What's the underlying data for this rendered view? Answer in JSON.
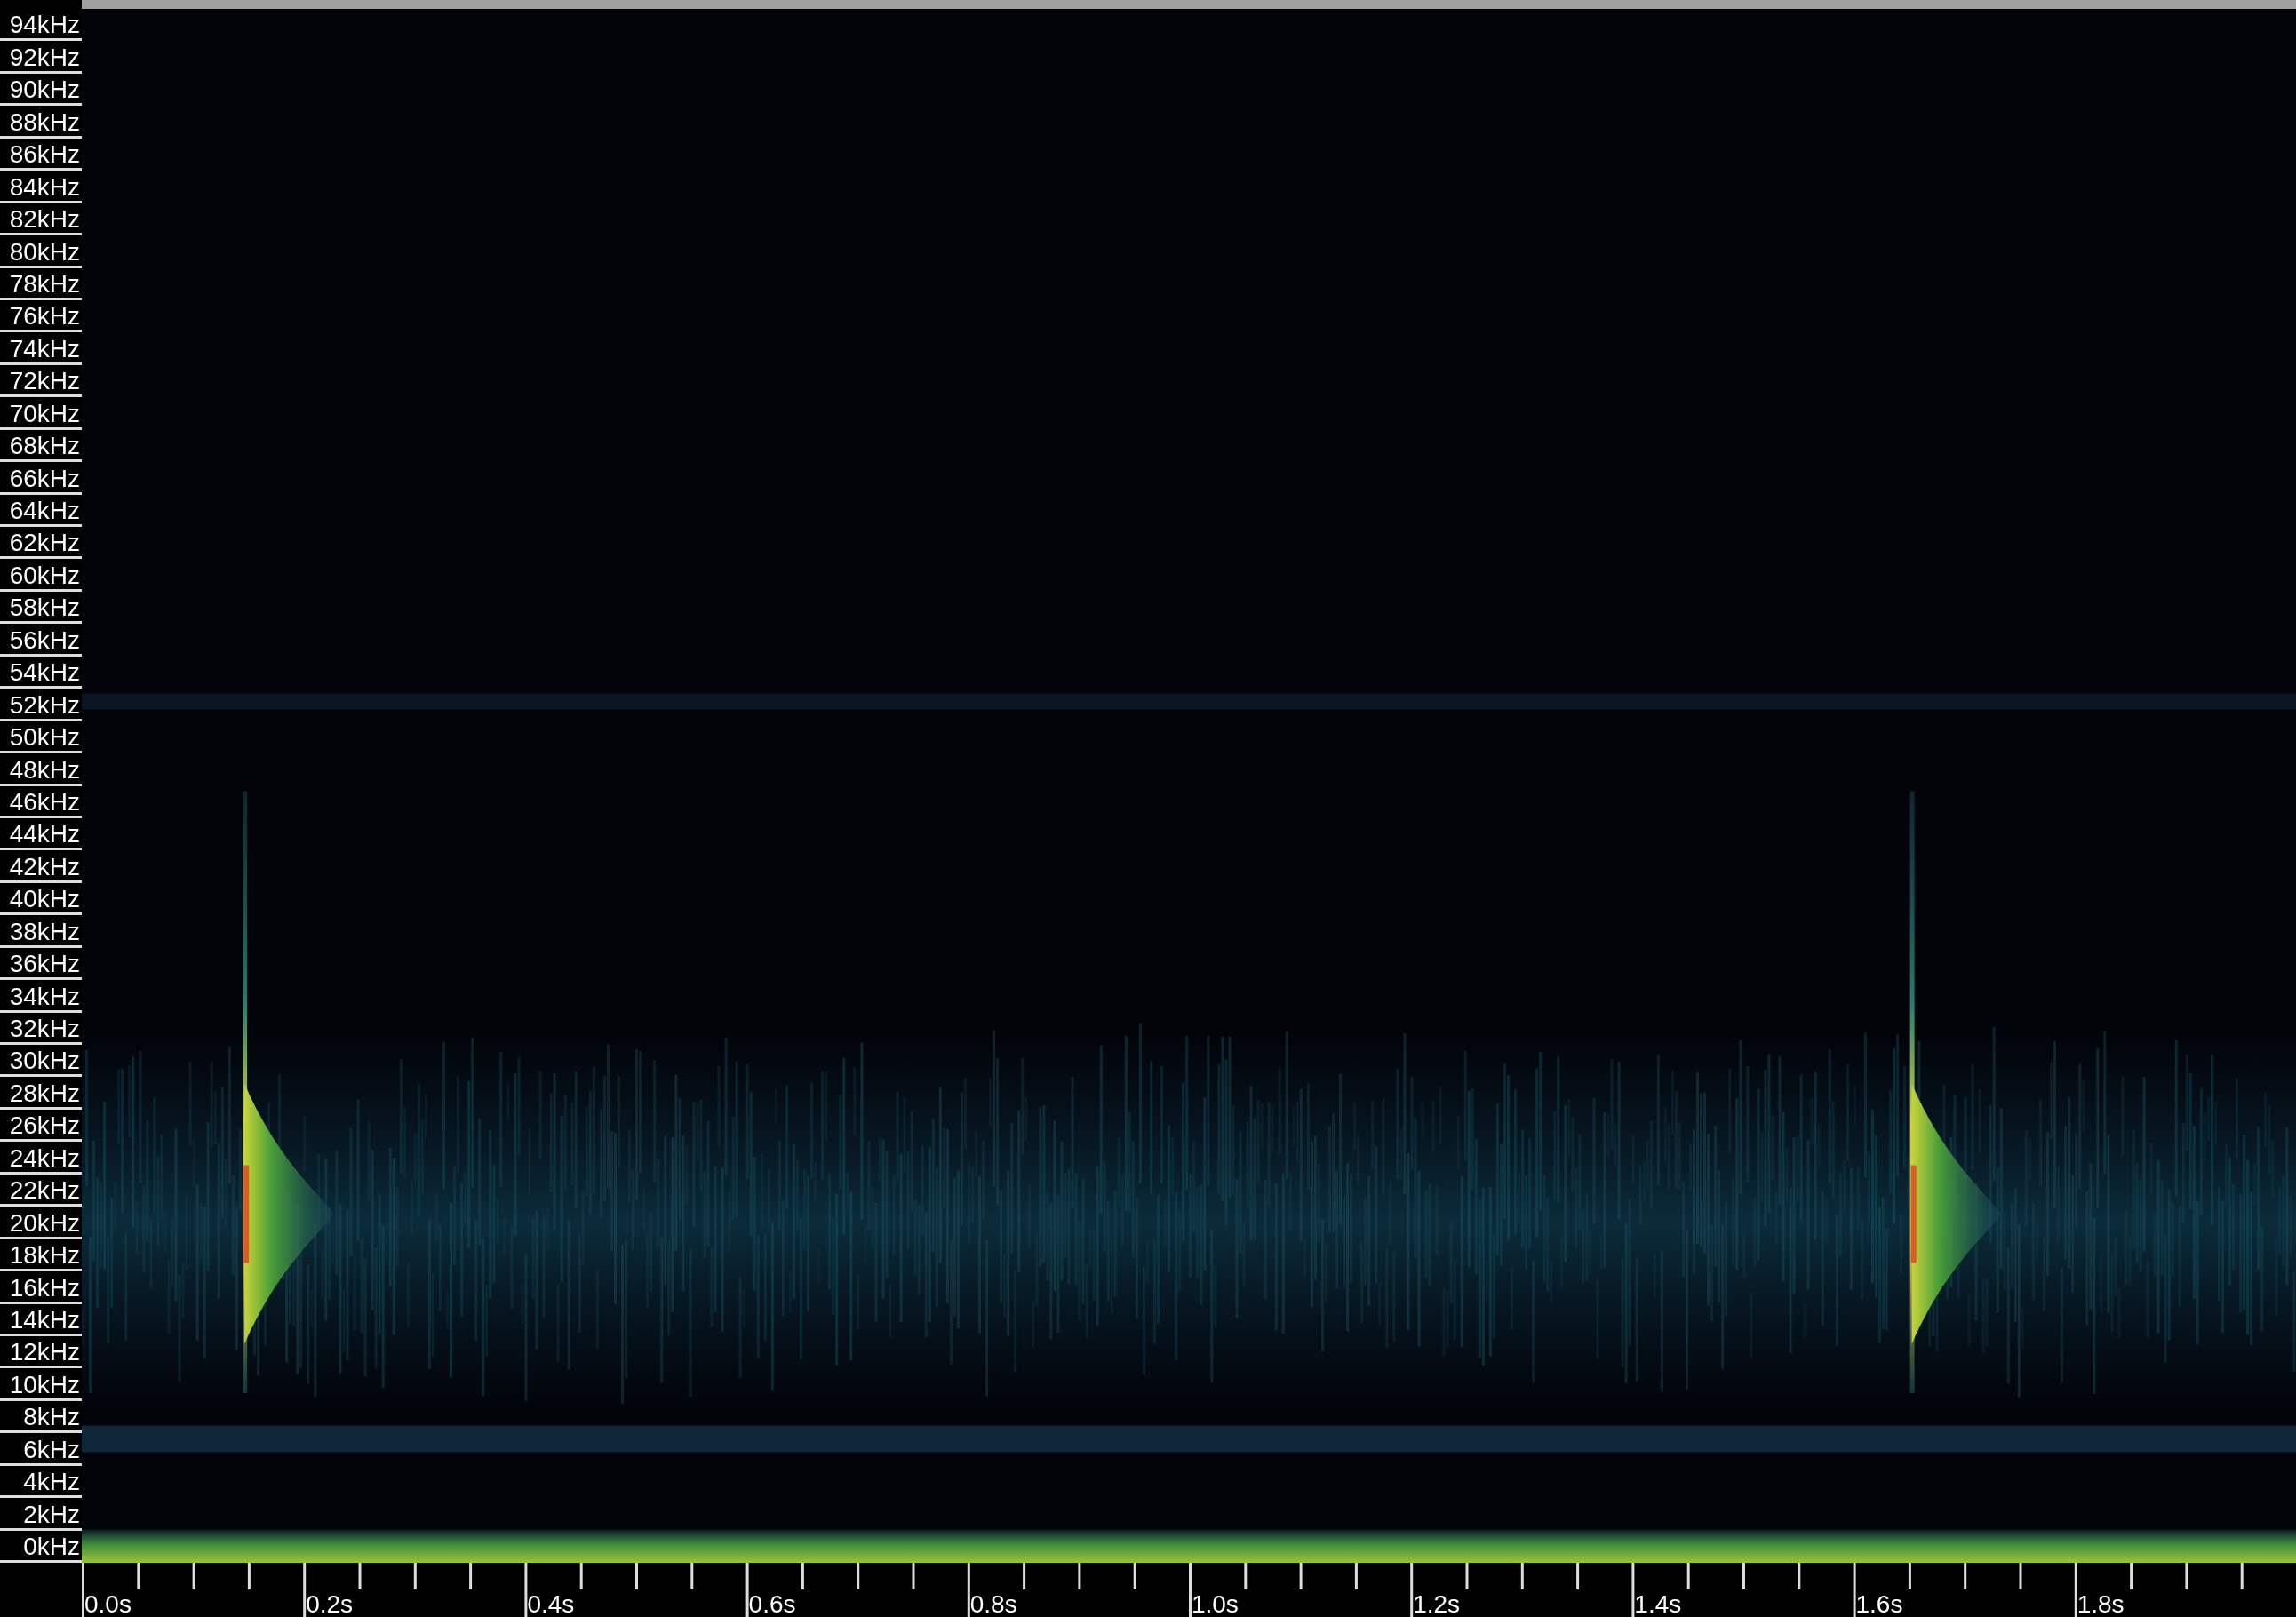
{
  "frequency_axis": {
    "labels": [
      "94kHz",
      "92kHz",
      "90kHz",
      "88kHz",
      "86kHz",
      "84kHz",
      "82kHz",
      "80kHz",
      "78kHz",
      "76kHz",
      "74kHz",
      "72kHz",
      "70kHz",
      "68kHz",
      "66kHz",
      "64kHz",
      "62kHz",
      "60kHz",
      "58kHz",
      "56kHz",
      "54kHz",
      "52kHz",
      "50kHz",
      "48kHz",
      "46kHz",
      "44kHz",
      "42kHz",
      "40kHz",
      "38kHz",
      "36kHz",
      "34kHz",
      "32kHz",
      "30kHz",
      "28kHz",
      "26kHz",
      "24kHz",
      "22kHz",
      "20kHz",
      "18kHz",
      "16kHz",
      "14kHz",
      "12kHz",
      "10kHz",
      "8kHz",
      "6kHz",
      "4kHz",
      "2kHz",
      "0kHz"
    ]
  },
  "time_axis": {
    "labels": [
      "0.0s",
      "0.2s",
      "0.4s",
      "0.6s",
      "0.8s",
      "1.0s",
      "1.2s",
      "1.4s",
      "1.6s",
      "1.8s"
    ]
  }
}
